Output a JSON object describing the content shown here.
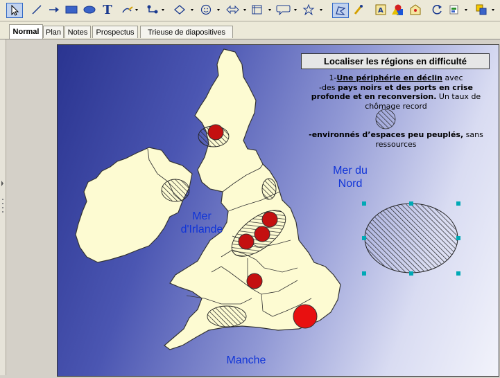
{
  "toolbar": {
    "icons": [
      "select-arrow-icon",
      "line-icon",
      "arrow-line-icon",
      "rectangle-icon",
      "ellipse-icon",
      "text-icon",
      "curve-icon",
      "connector-icon",
      "basic-shapes-icon",
      "symbol-shapes-icon",
      "block-arrows-icon",
      "flowchart-icon",
      "callouts-icon",
      "stars-icon",
      "points-icon",
      "glue-points-icon",
      "fontwork-icon",
      "from-file-icon",
      "gallery-icon",
      "rotate-icon",
      "align-icon",
      "arrange-icon"
    ]
  },
  "tabs": [
    {
      "label": "Normal",
      "active": true
    },
    {
      "label": "Plan",
      "active": false
    },
    {
      "label": "Notes",
      "active": false
    },
    {
      "label": "Prospectus",
      "active": false
    },
    {
      "label": "Trieuse de diapositives",
      "active": false
    }
  ],
  "slide": {
    "title": "Localiser les régions en difficulté",
    "line1_prefix": "1-",
    "line1_underlined": "Une périphérie en déclin",
    "line1_suffix": " avec",
    "line2_prefix": "-des ",
    "line2_bold": "pays noirs et des ports en crise",
    "line3_bold": "profonde et en reconversion.",
    "line3_suffix": " Un taux de",
    "line4": "chômage record",
    "line5_bold": "-environnés d’espaces peu peuplés,",
    "line5_suffix": " sans",
    "line6": "ressources",
    "sea_north_line1": "Mer du",
    "sea_north_line2": "Nord",
    "sea_irish_line1": "Mer",
    "sea_irish_line2": "d'Irlande",
    "channel": "Manche"
  },
  "colors": {
    "land": "#fdfbd2",
    "circle": "#c41010",
    "ocean_dark": "#2a3490",
    "selection_handle": "#00a9b5",
    "overlay_text": "#1034d8"
  }
}
